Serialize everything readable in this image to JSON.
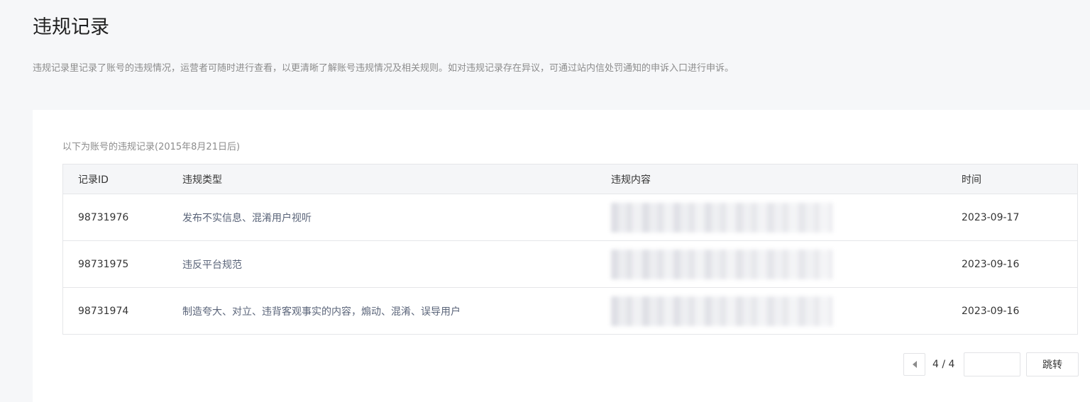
{
  "header": {
    "title": "违规记录",
    "description": "违规记录里记录了账号的违规情况，运营者可随时进行查看，以更清晰了解账号违规情况及相关规则。如对违规记录存在异议，可通过站内信处罚通知的申诉入口进行申诉。"
  },
  "card": {
    "caption": "以下为账号的违规记录(2015年8月21日后)"
  },
  "table": {
    "columns": [
      "记录ID",
      "违规类型",
      "违规内容",
      "时间"
    ],
    "rows": [
      {
        "id": "98731976",
        "type": "发布不实信息、混淆用户视听",
        "time": "2023-09-17"
      },
      {
        "id": "98731975",
        "type": "违反平台规范",
        "time": "2023-09-16"
      },
      {
        "id": "98731974",
        "type": "制造夸大、对立、违背客观事实的内容，煽动、混淆、误导用户",
        "time": "2023-09-16"
      }
    ]
  },
  "pagination": {
    "count": "4 / 4",
    "input_value": "",
    "jump_label": "跳转",
    "prev_icon": "caret-left-icon"
  }
}
